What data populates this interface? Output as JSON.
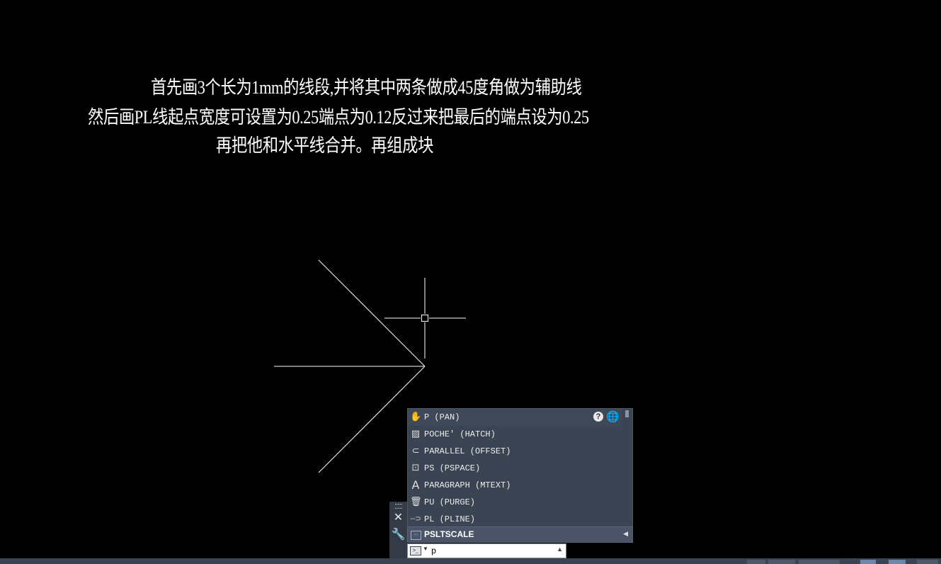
{
  "annotation": {
    "line1": "首先画3个长为1mm的线段,并将其中两条做成45度角做为辅助线",
    "line2": "然后画PL线起点宽度可设置为0.25端点为0.12反过来把最后的端点设为0.25",
    "line3": "再把他和水平线合并。再组成块"
  },
  "command_line": {
    "input_value": "p",
    "side_icons": [
      "grip-icon",
      "close-icon",
      "wrench-icon"
    ],
    "suggestions": [
      {
        "label": "P (PAN)",
        "icon": "pan-hand-icon"
      },
      {
        "label": "POCHE' (HATCH)",
        "icon": "hatch-icon"
      },
      {
        "label": "PARALLEL (OFFSET)",
        "icon": "offset-icon"
      },
      {
        "label": "PS (PSPACE)",
        "icon": "pspace-icon"
      },
      {
        "label": "PARAGRAPH (MTEXT)",
        "icon": "mtext-icon"
      },
      {
        "label": "PU (PURGE)",
        "icon": "purge-icon"
      },
      {
        "label": "PL (PLINE)",
        "icon": "pline-icon"
      }
    ],
    "system_variable": {
      "label": "PSLTSCALE",
      "icon": "sysvar-icon"
    }
  },
  "colors": {
    "background": "#000000",
    "lines": "#ffffff",
    "panel": "#3b4453",
    "accent": "#3a8ee6"
  }
}
